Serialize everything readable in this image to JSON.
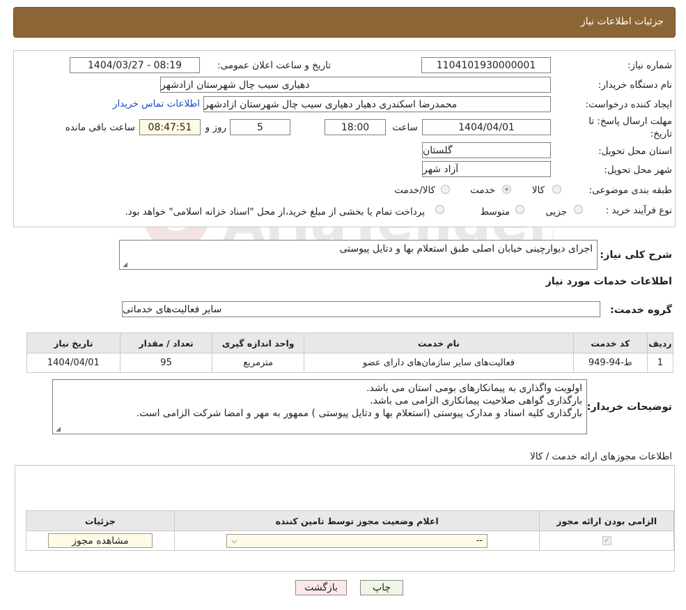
{
  "header": {
    "title": "جزئیات اطلاعات نیاز"
  },
  "form": {
    "need_number_label": "شماره نیاز:",
    "need_number": "1104101930000001",
    "announce_label": "تاریخ و ساعت اعلان عمومی:",
    "announce_value": "1404/03/27 - 08:19",
    "buyer_org_label": "نام دستگاه خریدار:",
    "buyer_org": "دهیاری سیب چال شهرستان ازادشهر",
    "creator_label": "ایجاد کننده درخواست:",
    "creator": "محمدرضا اسکندری دهیار دهیاری سیب چال شهرستان ازادشهر",
    "contact_link": "اطلاعات تماس خریدار",
    "deadline_label": "مهلت ارسال پاسخ: تا تاریخ:",
    "deadline_date": "1404/04/01",
    "time_label": "ساعت",
    "deadline_time": "18:00",
    "days_value": "5",
    "days_label": "روز و",
    "remaining_time": "08:47:51",
    "remaining_label": "ساعت باقی مانده",
    "province_label": "استان محل تحویل:",
    "province": "گلستان",
    "city_label": "شهر محل تحویل:",
    "city": "آزاد شهر",
    "category_label": "طبقه بندی موضوعی:",
    "category_options": [
      "کالا",
      "خدمت",
      "کالا/خدمت"
    ],
    "category_selected": "خدمت",
    "process_label": "نوع فرآیند خرید :",
    "process_options": [
      "جزیی",
      "متوسط"
    ],
    "process_note": "پرداخت تمام یا بخشی از مبلغ خرید،از محل \"اسناد خزانه اسلامی\" خواهد بود."
  },
  "summary": {
    "label": "شرح کلی نیاز:",
    "text": "اجرای دیوارچینی خیابان اصلی طبق استعلام بها و دتایل پیوستی"
  },
  "services": {
    "section_title": "اطلاعات خدمات مورد نیاز",
    "group_label": "گروه خدمت:",
    "group_value": "سایر فعالیت‌های خدماتی",
    "columns": [
      "ردیف",
      "کد خدمت",
      "نام خدمت",
      "واحد اندازه گیری",
      "تعداد / مقدار",
      "تاریخ نیاز"
    ],
    "rows": [
      [
        "1",
        "ط-94-949",
        "فعالیت‌های سایر سازمان‌های دارای عضو",
        "مترمربع",
        "95",
        "1404/04/01"
      ]
    ]
  },
  "buyer_notes": {
    "label": "توضیحات خریدار:",
    "lines": [
      "اولویت واگذاری به پیمانکارهای بومی استان می باشد.",
      "بارگذاری گواهی صلاحیت پیمانکاری الزامی می باشد.",
      "بارگذاری کلیه اسناد و مدارک پیوستی (استعلام بها و دتایل پیوستی ) ممهور به مهر و امضا شرکت الزامی است."
    ]
  },
  "permits": {
    "section_title": "اطلاعات مجوزهای ارائه خدمت / کالا",
    "columns": [
      "الزامی بودن ارائه مجوز",
      "اعلام وضعیت مجوز توسط تامین کننده",
      "جزئیات"
    ],
    "select_value": "--",
    "view_button": "مشاهده مجوز"
  },
  "buttons": {
    "print": "چاپ",
    "back": "بازگشت"
  },
  "watermark": {
    "text": "AriaTender.net"
  },
  "colors": {
    "header": "#8b6535",
    "link": "#1a4dc9",
    "back_button": "#fde8e8",
    "print_button": "#eef6e6"
  }
}
